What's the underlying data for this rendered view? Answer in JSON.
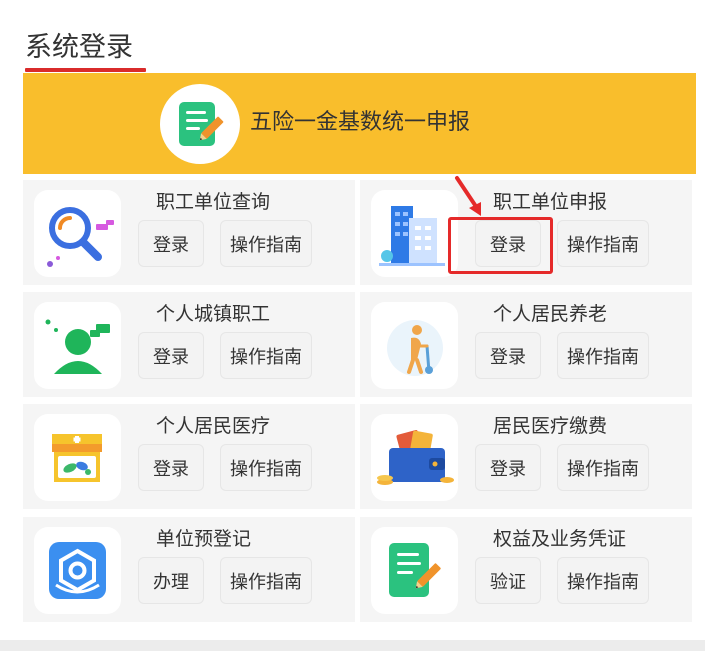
{
  "page": {
    "title": "系统登录"
  },
  "banner": {
    "label": "五险一金基数统一申报",
    "icon": "form-edit-icon"
  },
  "services": [
    {
      "title": "职工单位查询",
      "icon": "search-magnifier-icon",
      "primary": "登录",
      "guide": "操作指南"
    },
    {
      "title": "职工单位申报",
      "icon": "office-building-icon",
      "primary": "登录",
      "guide": "操作指南"
    },
    {
      "title": "个人城镇职工",
      "icon": "person-chat-icon",
      "primary": "登录",
      "guide": "操作指南"
    },
    {
      "title": "个人居民养老",
      "icon": "elderly-person-icon",
      "primary": "登录",
      "guide": "操作指南"
    },
    {
      "title": "个人居民医疗",
      "icon": "pharmacy-shop-icon",
      "primary": "登录",
      "guide": "操作指南"
    },
    {
      "title": "居民医疗缴费",
      "icon": "wallet-coins-icon",
      "primary": "登录",
      "guide": "操作指南"
    },
    {
      "title": "单位预登记",
      "icon": "hexagon-gear-icon",
      "primary": "办理",
      "guide": "操作指南"
    },
    {
      "title": "权益及业务凭证",
      "icon": "document-edit-icon",
      "primary": "验证",
      "guide": "操作指南"
    }
  ],
  "colors": {
    "banner": "#f9be2c",
    "title_underline": "#d92b2b",
    "highlight": "#e52a2a",
    "card_bg": "#f5f5f5"
  }
}
